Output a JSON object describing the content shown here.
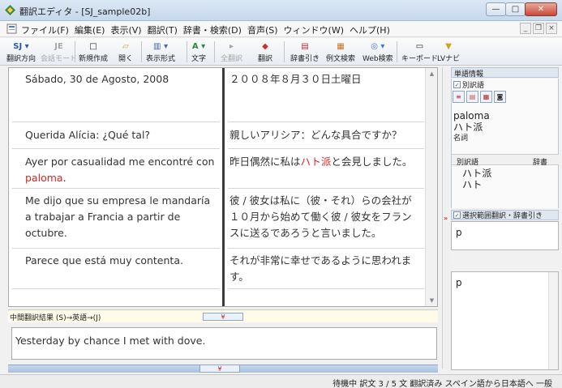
{
  "window": {
    "title": "翻訳エディタ - [SJ_sample02b]",
    "minimize": "—",
    "maximize": "□",
    "close": "✕"
  },
  "menu": {
    "items": [
      "ファイル(F)",
      "編集(E)",
      "表示(V)",
      "翻訳(T)",
      "辞書・検索(D)",
      "音声(S)",
      "ウィンドウ(W)",
      "ヘルプ(H)"
    ],
    "mdi": [
      "_",
      "❐",
      "×"
    ]
  },
  "toolbar": {
    "direction_icon": "SJ ▾",
    "direction": "翻訳方向",
    "mode_icon": "JE",
    "mode": "会話モード",
    "new_icon": "□",
    "new": "新規作成",
    "open_icon": "▱",
    "open": "開く",
    "display_icon": "▥ ▾",
    "display": "表示形式",
    "text_icon": "A ▾",
    "text": "文字",
    "all_icon": "▸",
    "all": "全翻訳",
    "translate_icon": "◆",
    "translate": "翻訳",
    "dict_icon": "▤",
    "dict": "辞書引き",
    "example_icon": "▦",
    "example": "例文検索",
    "web_icon": "◎ ▾",
    "web": "Web検索",
    "keyboard_icon": "▭",
    "keyboard": "キーボード",
    "lv_icon": "▼",
    "lv": "LVナビ"
  },
  "editor": {
    "source": [
      "Sábado, 30 de Agosto, 2008",
      "Querida Alícia: ¿Qué tal?",
      "Ayer por casualidad me encontré con",
      "paloma",
      ".",
      "Me dijo que su empresa le mandaría",
      "a trabajar a Francia a partir de",
      "octubre.",
      "Parece que está muy contenta."
    ],
    "target": [
      "２００８年８月３０日土曜日",
      "親しいアリシア：どんな具合ですか？",
      "昨日偶然に私は",
      "ハト派",
      "と会見しました。",
      "彼 / 彼女は私に（彼・それ）らの会社が",
      "１０月から始めて働く彼 / 彼女をフラン",
      "スに送るであろうと言いました。",
      "それが非常に幸せであるように思われま",
      "す。"
    ]
  },
  "intermediate": {
    "label": "中間翻訳結果 (S)→英語→(J)",
    "collapse": "¥",
    "result": "Yesterday by chance I met with dove.",
    "expand": "¥"
  },
  "word_info": {
    "header": "単語情報",
    "alt_label": "別訳語",
    "alt_checked": "✓",
    "tools": [
      "≡",
      "▤",
      "▦",
      "◙"
    ],
    "word": "paloma",
    "translation": "ハト派",
    "pos": "名詞",
    "col_alt": "別訳語",
    "col_dict": "辞書",
    "alternatives": [
      "ハト派",
      "ハト"
    ]
  },
  "selection": {
    "expand": "»",
    "checked": "✓",
    "label": "選択範囲翻訳・辞書引き",
    "input": "p",
    "output": "p"
  },
  "status": {
    "text": "待機中  訳文  3 / 5 文  翻訳済み  スペイン語から日本語へ  一般"
  },
  "scroll": {
    "up": "▲",
    "down": "▼"
  }
}
